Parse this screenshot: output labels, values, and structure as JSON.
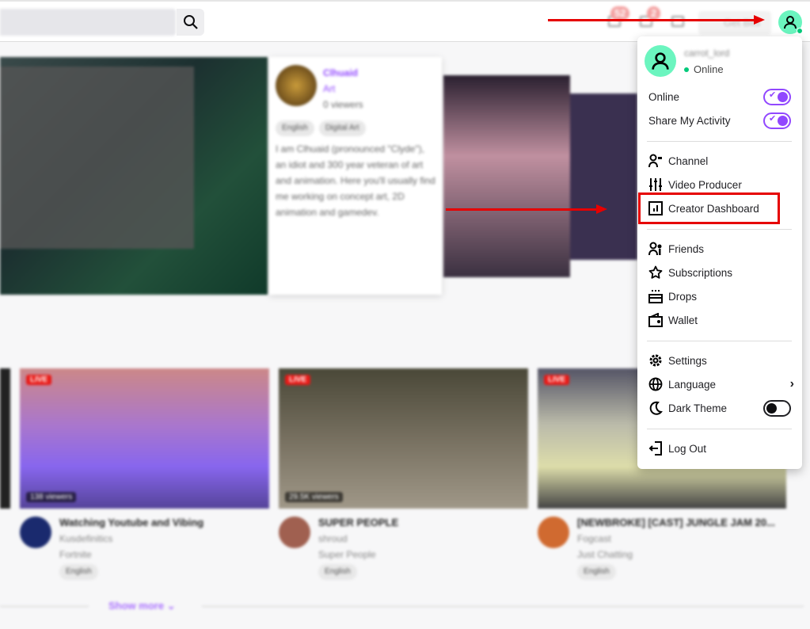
{
  "topbar": {
    "badges": [
      "52",
      "2"
    ],
    "get_bits": "Get Bits"
  },
  "featured": {
    "channel": "Clhuaid",
    "category": "Art",
    "viewers": "0 viewers",
    "tags": [
      "English",
      "Digital Art"
    ],
    "description": "I am Clhuaid (pronounced \"Clyde\"), an idiot and 300 year veteran of art and animation. Here you'll usually find me working on concept art, 2D animation and gamedev."
  },
  "cards": [
    {
      "live": "LIVE",
      "viewers": "138 viewers",
      "title": "Watching Youtube and Vibing",
      "channel": "Kusdefinitics",
      "category": "Fortnite",
      "tag": "English",
      "avatar_color": "#1a2a6e"
    },
    {
      "live": "LIVE",
      "viewers": "29.5K viewers",
      "title": "SUPER PEOPLE",
      "channel": "shroud",
      "category": "Super People",
      "tag": "English",
      "avatar_color": "#a06050"
    },
    {
      "live": "LIVE",
      "viewers": "",
      "title": "[NEWBROKE] [CAST] JUNGLE JAM 20...",
      "channel": "Fogcast",
      "category": "Just Chatting",
      "tag": "English",
      "avatar_color": "#d06a30"
    }
  ],
  "show_more": "Show more",
  "menu": {
    "username": "carrot_lord",
    "status": "Online",
    "toggles": [
      {
        "label": "Online",
        "on": true
      },
      {
        "label": "Share My Activity",
        "on": true
      }
    ],
    "group1": [
      {
        "label": "Channel",
        "icon": "channel-icon"
      },
      {
        "label": "Video Producer",
        "icon": "sliders-icon"
      },
      {
        "label": "Creator Dashboard",
        "icon": "dashboard-icon"
      }
    ],
    "group2": [
      {
        "label": "Friends",
        "icon": "friends-icon"
      },
      {
        "label": "Subscriptions",
        "icon": "star-icon"
      },
      {
        "label": "Drops",
        "icon": "drops-icon"
      },
      {
        "label": "Wallet",
        "icon": "wallet-icon"
      }
    ],
    "group3": [
      {
        "label": "Settings",
        "icon": "gear-icon"
      },
      {
        "label": "Language",
        "icon": "globe-icon"
      },
      {
        "label": "Dark Theme",
        "icon": "moon-icon",
        "on": false
      }
    ],
    "logout": "Log Out"
  },
  "colors": {
    "accent": "#9147ff",
    "avatar": "#6bf5bf",
    "annotation": "#e60000"
  }
}
